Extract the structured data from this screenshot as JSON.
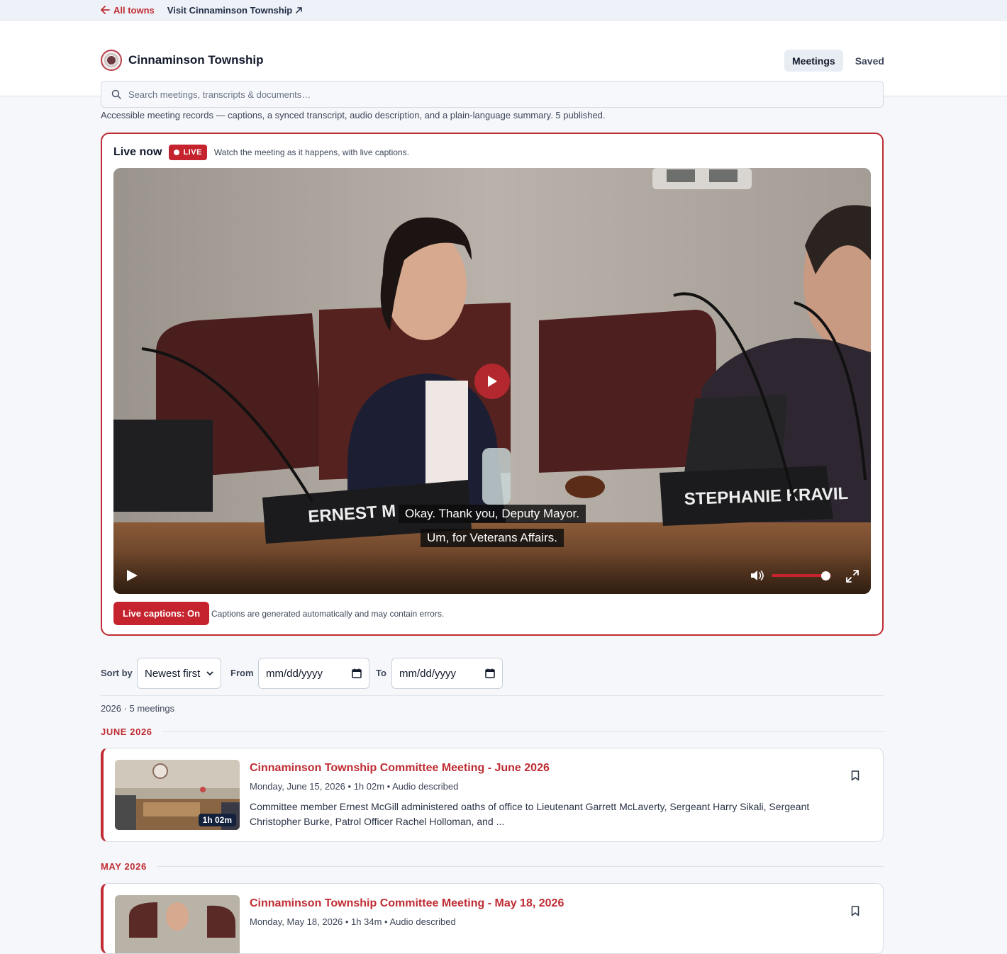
{
  "topbar": {
    "back_label": "All towns",
    "visit_label": "Visit Cinnaminson Township"
  },
  "header": {
    "brand_name": "Cinnaminson Township",
    "nav": [
      {
        "label": "Meetings",
        "active": true
      },
      {
        "label": "Saved",
        "active": false
      }
    ],
    "search_placeholder": "Search meetings, transcripts & documents…"
  },
  "intro": "Accessible meeting records — captions, a synced transcript, audio description, and a plain-language summary. 5 published.",
  "live": {
    "title": "Live now",
    "badge": "LIVE",
    "subtitle": "Watch the meeting as it happens, with live captions.",
    "nameplate_left": "ERNEST M",
    "nameplate_right": "STEPHANIE KRAVIL",
    "caption_line_1": "Okay. Thank you, Deputy Mayor.",
    "caption_line_2": "Um, for Veterans Affairs.",
    "volume_level": 0.9,
    "captions_button": "Live captions: On",
    "captions_note": "Captions are generated automatically and may contain errors."
  },
  "filters": {
    "sort_label": "Sort by",
    "sort_value": "Newest first",
    "from_label": "From",
    "from_placeholder": "mm/dd/yyyy",
    "to_label": "To",
    "to_placeholder": "mm/dd/yyyy"
  },
  "result_count": "2026 · 5 meetings",
  "groups": [
    {
      "month": "JUNE 2026",
      "meetings": [
        {
          "title": "Cinnaminson Township Committee Meeting - June 2026",
          "meta": "Monday, June 15, 2026 • 1h 02m • Audio described",
          "summary": "Committee member Ernest McGill administered oaths of office to Lieutenant Garrett McLaverty, Sergeant Harry Sikali, Sergeant Christopher Burke, Patrol Officer Rachel Holloman, and ...",
          "duration": "1h 02m"
        }
      ]
    },
    {
      "month": "MAY 2026",
      "meetings": [
        {
          "title": "Cinnaminson Township Committee Meeting - May 18, 2026",
          "meta": "Monday, May 18, 2026 • 1h 34m • Audio described"
        }
      ]
    }
  ],
  "colors": {
    "accent": "#bf2c33",
    "live_red": "#c5232d",
    "navy": "#14213d"
  },
  "icons": [
    "arrow-left-icon",
    "external-link-icon",
    "search-icon",
    "play-icon",
    "volume-icon",
    "fullscreen-icon",
    "calendar-icon",
    "chevron-down-icon",
    "bookmark-icon"
  ]
}
